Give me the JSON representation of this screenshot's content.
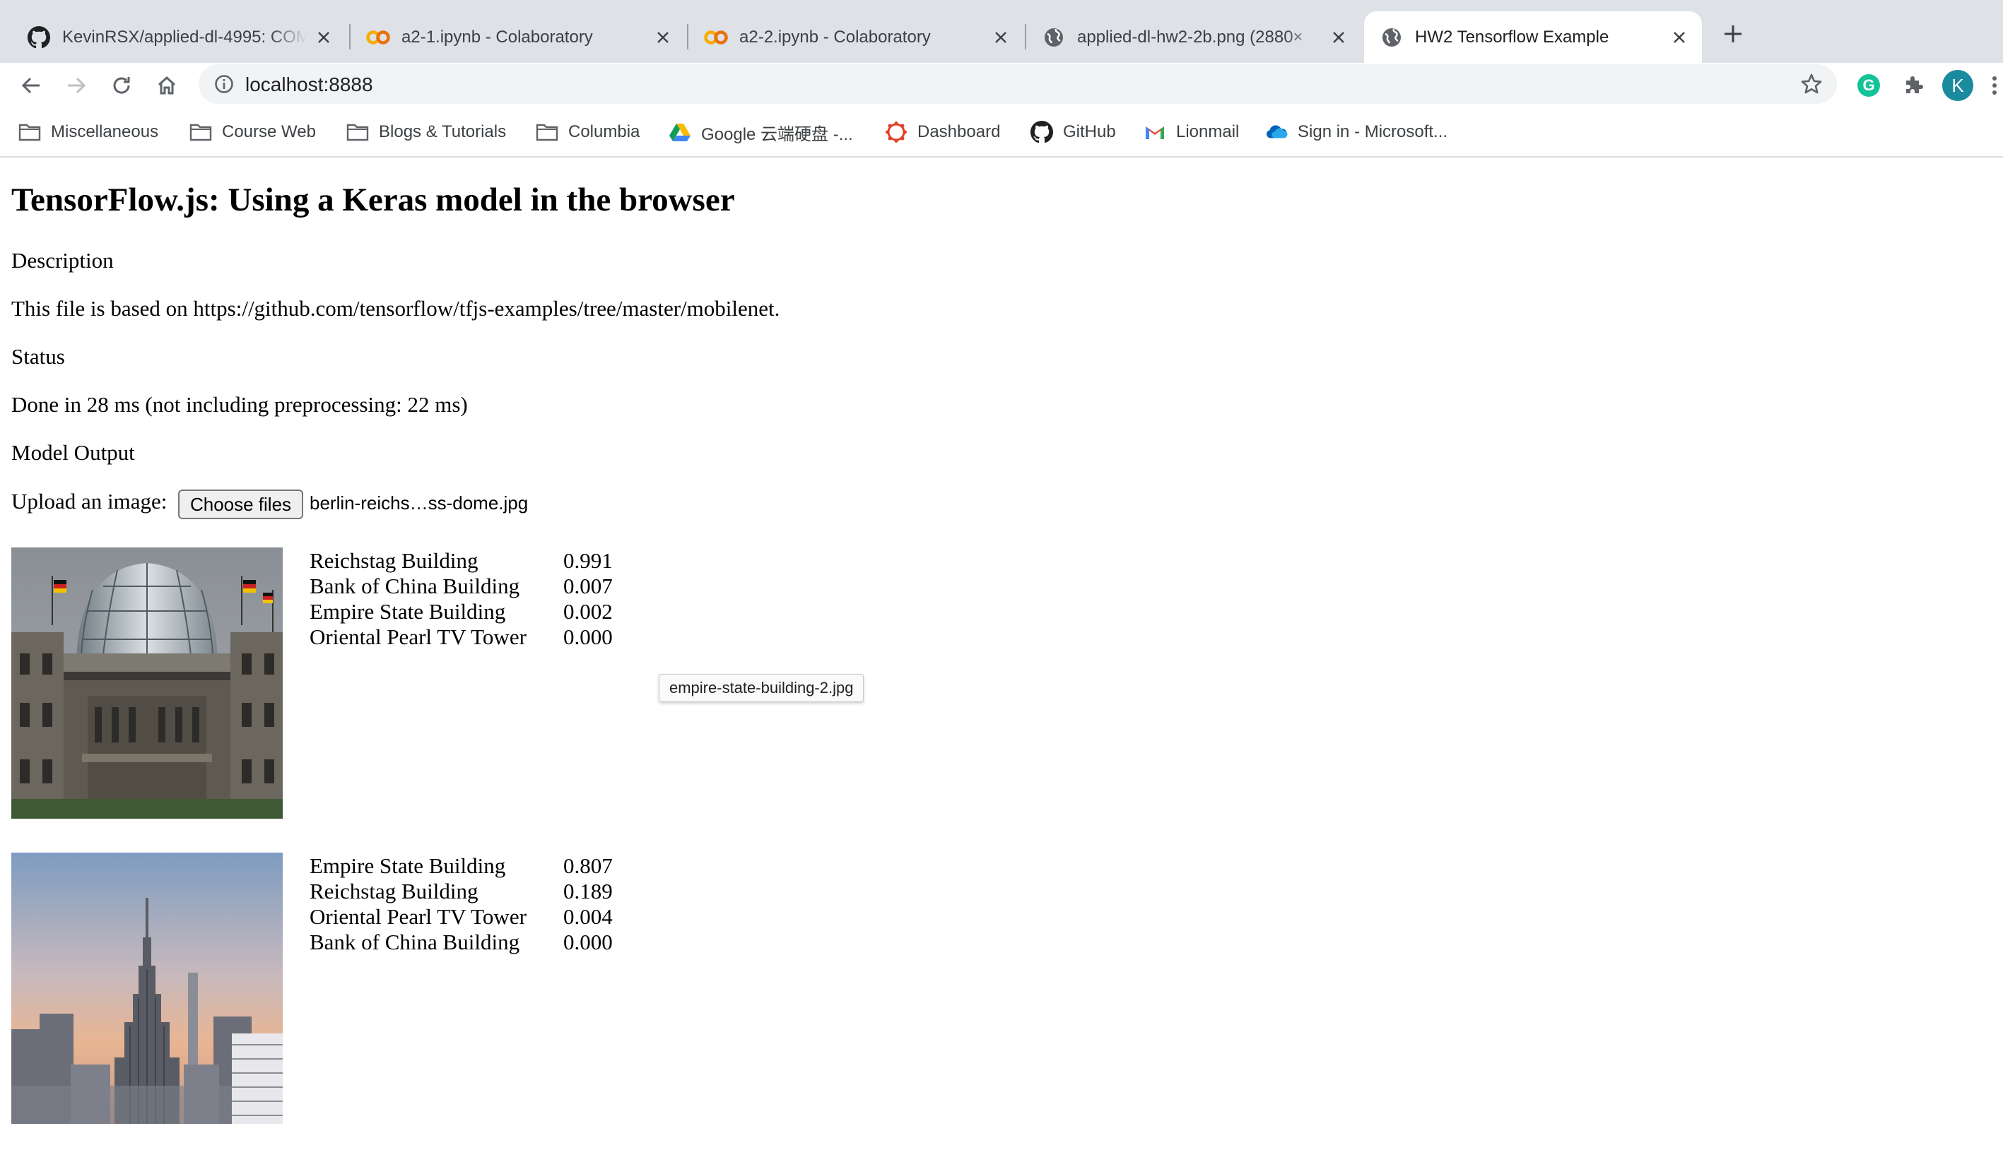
{
  "browser": {
    "tabs": [
      {
        "title": "KevinRSX/applied-dl-4995: COMS",
        "icon": "github-icon",
        "active": false
      },
      {
        "title": "a2-1.ipynb - Colaboratory",
        "icon": "colab-icon",
        "active": false
      },
      {
        "title": "a2-2.ipynb - Colaboratory",
        "icon": "colab-icon",
        "active": false
      },
      {
        "title": "applied-dl-hw2-2b.png (2880×",
        "icon": "globe-icon",
        "active": false
      },
      {
        "title": "HW2 Tensorflow Example",
        "icon": "globe-icon",
        "active": true
      }
    ],
    "url": "localhost:8888",
    "profile_initial": "K",
    "extension_initial": "G",
    "bookmarks": [
      {
        "label": "Miscellaneous",
        "icon": "folder-icon"
      },
      {
        "label": "Course Web",
        "icon": "folder-icon"
      },
      {
        "label": "Blogs & Tutorials",
        "icon": "folder-icon"
      },
      {
        "label": "Columbia",
        "icon": "folder-icon"
      },
      {
        "label": "Google 云端硬盘 -...",
        "icon": "google-drive-icon"
      },
      {
        "label": "Dashboard",
        "icon": "canvas-icon"
      },
      {
        "label": "GitHub",
        "icon": "github-icon"
      },
      {
        "label": "Lionmail",
        "icon": "gmail-icon"
      },
      {
        "label": "Sign in - Microsoft...",
        "icon": "onedrive-icon"
      }
    ],
    "colors": {
      "tabstrip": "#dee1e6",
      "omnibox": "#f1f3f4",
      "profile": "#1a73e8"
    }
  },
  "page": {
    "heading": "TensorFlow.js: Using a Keras model in the browser",
    "description_label": "Description",
    "description_text": "This file is based on https://github.com/tensorflow/tfjs-examples/tree/master/mobilenet.",
    "status_label": "Status",
    "status_text": "Done in 28 ms (not including preprocessing: 22 ms)",
    "model_output_label": "Model Output",
    "upload_label": "Upload an image:",
    "choose_files_label": "Choose files",
    "chosen_file": "berlin-reichs…ss-dome.jpg",
    "tooltip": "empire-state-building-2.jpg",
    "results": [
      {
        "image": "reichstag-photo",
        "predictions": [
          {
            "label": "Reichstag Building",
            "prob": "0.991"
          },
          {
            "label": "Bank of China Building",
            "prob": "0.007"
          },
          {
            "label": "Empire State Building",
            "prob": "0.002"
          },
          {
            "label": "Oriental Pearl TV Tower",
            "prob": "0.000"
          }
        ]
      },
      {
        "image": "empire-state-photo",
        "predictions": [
          {
            "label": "Empire State Building",
            "prob": "0.807"
          },
          {
            "label": "Reichstag Building",
            "prob": "0.189"
          },
          {
            "label": "Oriental Pearl TV Tower",
            "prob": "0.004"
          },
          {
            "label": "Bank of China Building",
            "prob": "0.000"
          }
        ]
      }
    ]
  }
}
